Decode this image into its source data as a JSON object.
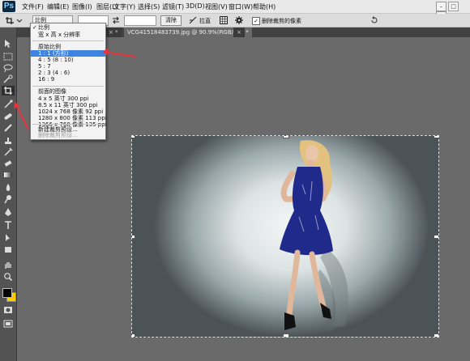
{
  "app": {
    "logo": "Ps"
  },
  "menubar": {
    "items": [
      "文件(F)",
      "编辑(E)",
      "图像(I)",
      "图层(L)",
      "文字(Y)",
      "选择(S)",
      "滤镜(T)",
      "3D(D)",
      "视图(V)",
      "窗口(W)",
      "帮助(H)"
    ],
    "window_controls": [
      "–",
      "□",
      "×"
    ]
  },
  "options_bar": {
    "ratio_select": "比例",
    "clear_label": "清除",
    "straighten_label": "拉直",
    "delete_cropped_label": "删除裁剪的像素",
    "delete_cropped_checked": "✓"
  },
  "tabs": [
    {
      "label": "× *",
      "active": false
    },
    {
      "label": "VCG41518483739.jpg @ 90.9%(RGB/8#) *",
      "active": true
    },
    {
      "label": "×",
      "active": false
    }
  ],
  "dropdown": {
    "items": [
      {
        "label": "比例",
        "checked": true,
        "type": "item"
      },
      {
        "label": "宽 x 高 x 分辨率",
        "type": "item"
      },
      {
        "type": "sep"
      },
      {
        "label": "原始比例",
        "type": "item"
      },
      {
        "label": "1 : 1 (方形)",
        "type": "item",
        "selected": true
      },
      {
        "label": "4 : 5 (8 : 10)",
        "type": "item"
      },
      {
        "label": "5 : 7",
        "type": "item"
      },
      {
        "label": "2 : 3 (4 : 6)",
        "type": "item"
      },
      {
        "label": "16 : 9",
        "type": "item"
      },
      {
        "type": "sep"
      },
      {
        "label": "前面的图像",
        "type": "item"
      },
      {
        "label": "4 x 5 英寸 300 ppi",
        "type": "item"
      },
      {
        "label": "8.5 x 11 英寸 300 ppi",
        "type": "item"
      },
      {
        "label": "1024 x 768 像素 92 ppi",
        "type": "item"
      },
      {
        "label": "1280 x 800 像素 113 ppi",
        "type": "item"
      },
      {
        "label": "1366 x 768 像素 135 ppi",
        "type": "item"
      },
      {
        "type": "sep"
      },
      {
        "label": "新建裁剪预设...",
        "type": "item"
      },
      {
        "label": "删除裁剪预设...",
        "type": "item",
        "disabled": true
      }
    ]
  },
  "colors": {
    "accent": "#3d84e0",
    "arrow": "#e8333a",
    "dress": "#1f2a8a",
    "foreground_swatch": "#000000",
    "background_swatch": "#ffcc00"
  },
  "toolbar": {
    "icons": [
      "move-icon",
      "marquee-icon",
      "lasso-icon",
      "quick-select-icon",
      "crop-icon",
      "eyedropper-icon",
      "healing-icon",
      "brush-icon",
      "stamp-icon",
      "history-brush-icon",
      "eraser-icon",
      "gradient-icon",
      "blur-icon",
      "dodge-icon",
      "pen-icon",
      "type-icon",
      "path-select-icon",
      "shape-icon",
      "hand-icon",
      "zoom-icon",
      "color-swatches-icon",
      "quick-mask-icon",
      "screen-mode-icon"
    ]
  }
}
